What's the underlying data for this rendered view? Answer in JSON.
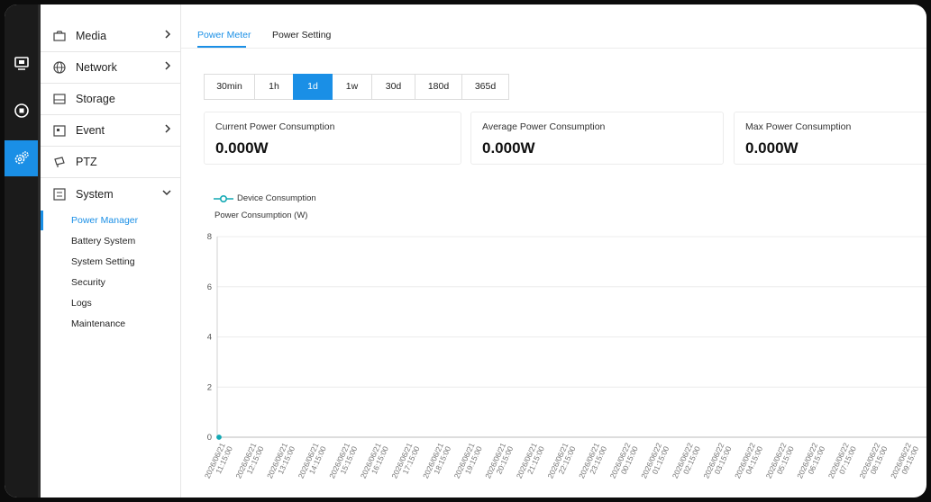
{
  "sidebar": {
    "menu": [
      {
        "label": "Media",
        "icon": "media-icon",
        "arrow": "right"
      },
      {
        "label": "Network",
        "icon": "globe-icon",
        "arrow": "right"
      },
      {
        "label": "Storage",
        "icon": "storage-icon",
        "arrow": ""
      },
      {
        "label": "Event",
        "icon": "event-icon",
        "arrow": "right"
      },
      {
        "label": "PTZ",
        "icon": "ptz-icon",
        "arrow": ""
      },
      {
        "label": "System",
        "icon": "system-icon",
        "arrow": "down"
      }
    ],
    "submenu": [
      "Power Manager",
      "Battery System",
      "System Setting",
      "Security",
      "Logs",
      "Maintenance"
    ],
    "active_submenu": "Power Manager"
  },
  "tabs": [
    {
      "label": "Power Meter",
      "active": true
    },
    {
      "label": "Power Setting",
      "active": false
    }
  ],
  "time_ranges": [
    "30min",
    "1h",
    "1d",
    "1w",
    "30d",
    "180d",
    "365d"
  ],
  "active_range": "1d",
  "cards": [
    {
      "label": "Current Power Consumption",
      "value": "0.000W"
    },
    {
      "label": "Average Power Consumption",
      "value": "0.000W"
    },
    {
      "label": "Max Power Consumption",
      "value": "0.000W"
    }
  ],
  "colors": {
    "accent": "#1a8fe6",
    "series": "#13a9b4"
  },
  "chart_data": {
    "type": "line",
    "ylabel": "Power Consumption (W)",
    "ylim": [
      0,
      8
    ],
    "yticks": [
      0,
      2,
      4,
      6,
      8
    ],
    "grid": true,
    "legend_position": "top-left",
    "x": [
      "2026/06/21 11:15:00",
      "2026/06/21 12:15:00",
      "2026/06/21 13:15:00",
      "2026/06/21 14:15:00",
      "2026/06/21 15:15:00",
      "2026/06/21 16:15:00",
      "2026/06/21 17:15:00",
      "2026/06/21 18:15:00",
      "2026/06/21 19:15:00",
      "2026/06/21 20:15:00",
      "2026/06/21 21:15:00",
      "2026/06/21 22:15:00",
      "2026/06/21 23:15:00",
      "2026/06/22 00:15:00",
      "2026/06/22 01:15:00",
      "2026/06/22 02:15:00",
      "2026/06/22 03:15:00",
      "2026/06/22 04:15:00",
      "2026/06/22 05:15:00",
      "2026/06/22 06:15:00",
      "2026/06/22 07:15:00",
      "2026/06/22 08:15:00",
      "2026/06/22 09:15:00"
    ],
    "series": [
      {
        "name": "Device Consumption",
        "points": [
          {
            "x": "2026/06/21 11:15:00",
            "y": 0
          }
        ]
      }
    ]
  }
}
